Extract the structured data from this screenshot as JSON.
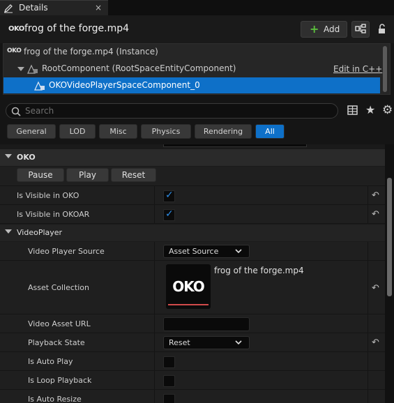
{
  "tab": {
    "label": "Details",
    "close": "×"
  },
  "header": {
    "actor_icon": "OKO",
    "actor_name": "frog of the forge.mp4",
    "add_label": "Add",
    "add_plus": "+"
  },
  "tree": {
    "items": [
      {
        "label": "frog of the forge.mp4 (Instance)"
      },
      {
        "label": "RootComponent (RootSpaceEntityComponent)"
      },
      {
        "label": "OKOVideoPlayerSpaceComponent_0"
      }
    ],
    "edit_link": "Edit in C++"
  },
  "search": {
    "placeholder": "Search"
  },
  "filters": [
    "General",
    "LOD",
    "Misc",
    "Physics",
    "Rendering",
    "All"
  ],
  "filters_active": "All",
  "categories": {
    "oko": {
      "label": "OKO",
      "buttons": [
        "Pause",
        "Play",
        "Reset"
      ],
      "rows": [
        {
          "name": "Is Visible in OKO",
          "checked": true
        },
        {
          "name": "Is Visible in OKOAR",
          "checked": true
        }
      ]
    },
    "videoplayer": {
      "label": "VideoPlayer",
      "video_player_source": {
        "name": "Video Player Source",
        "value": "Asset Source"
      },
      "asset_collection": {
        "name": "Asset Collection",
        "thumb_logo": "OKO",
        "asset_name": "frog of the forge.mp4"
      },
      "video_asset_url": {
        "name": "Video Asset URL",
        "value": ""
      },
      "playback_state": {
        "name": "Playback State",
        "value": "Reset"
      },
      "is_auto_play": {
        "name": "Is Auto Play",
        "checked": false
      },
      "is_loop_playback": {
        "name": "Is Loop Playback",
        "checked": false
      },
      "is_auto_resize": {
        "name": "Is Auto Resize",
        "checked": false
      }
    }
  },
  "colors": {
    "accent": "#0e70c8",
    "add_plus": "#5bbd3d",
    "check": "#2e8ee8",
    "thumb_bar": "#d14a4a"
  }
}
